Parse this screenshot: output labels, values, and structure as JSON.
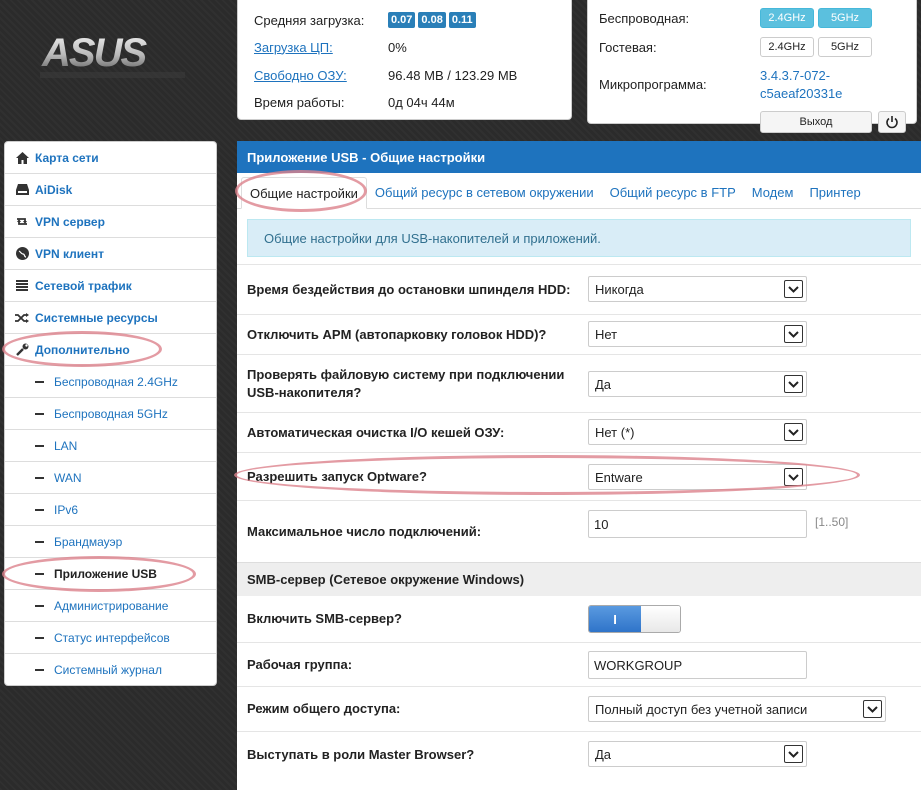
{
  "brand": {
    "logo_text": "ASUS"
  },
  "status": {
    "load_label": "Средняя загрузка:",
    "load_values": [
      "0.07",
      "0.08",
      "0.11"
    ],
    "cpu_label": "Загрузка ЦП:",
    "cpu_value": "0%",
    "ram_label": "Свободно ОЗУ:",
    "ram_value": "96.48 MB / 123.29 MB",
    "uptime_label": "Время работы:",
    "uptime_value": "0д 04ч 44м"
  },
  "router": {
    "wireless_label": "Беспроводная:",
    "guest_label": "Гостевая:",
    "band_24": "2.4GHz",
    "band_5": "5GHz",
    "firmware_label": "Микропрограмма:",
    "firmware_line1": "3.4.3.7-072-",
    "firmware_line2": "c5aeaf20331e",
    "logout_label": "Выход"
  },
  "sidebar": {
    "items": [
      {
        "label": "Карта сети",
        "icon": "home-icon"
      },
      {
        "label": "AiDisk",
        "icon": "drive-icon"
      },
      {
        "label": "VPN сервер",
        "icon": "retweet-icon"
      },
      {
        "label": "VPN клиент",
        "icon": "globe-icon"
      },
      {
        "label": "Сетевой трафик",
        "icon": "list-icon"
      },
      {
        "label": "Системные ресурсы",
        "icon": "shuffle-icon"
      },
      {
        "label": "Дополнительно",
        "icon": "wrench-icon"
      }
    ],
    "subitems": [
      "Беспроводная 2.4GHz",
      "Беспроводная 5GHz",
      "LAN",
      "WAN",
      "IPv6",
      "Брандмауэр",
      "Приложение USB",
      "Администрирование",
      "Статус интерфейсов",
      "Системный журнал"
    ]
  },
  "main": {
    "title": "Приложение USB - Общие настройки",
    "tabs": [
      "Общие настройки",
      "Общий ресурс в сетевом окружении",
      "Общий ресурс в FTP",
      "Модем",
      "Принтер"
    ],
    "info": "Общие настройки для USB-накопителей и приложений.",
    "fields": {
      "spindown_label": "Время бездействия до остановки шпинделя HDD:",
      "spindown_value": "Никогда",
      "apm_label": "Отключить APM (автопарковку головок HDD)?",
      "apm_value": "Нет",
      "fscheck_label_1": "Проверять файловую систему при подключении",
      "fscheck_label_2": "USB-накопителя?",
      "fscheck_value": "Да",
      "cache_label": "Автоматическая очистка I/O кешей ОЗУ:",
      "cache_value": "Нет (*)",
      "optware_label": "Разрешить запуск Optware?",
      "optware_value": "Entware",
      "maxconn_label": "Максимальное число подключений:",
      "maxconn_value": "10",
      "maxconn_hint": "[1..50]"
    },
    "smb": {
      "section": "SMB-сервер (Сетевое окружение Windows)",
      "enable_label": "Включить SMB-сервер?",
      "enable_on": "I",
      "workgroup_label": "Рабочая группа:",
      "workgroup_value": "WORKGROUP",
      "access_label": "Режим общего доступа:",
      "access_value": "Полный доступ без учетной записи",
      "master_label": "Выступать в роли Master Browser?",
      "master_value": "Да"
    }
  }
}
